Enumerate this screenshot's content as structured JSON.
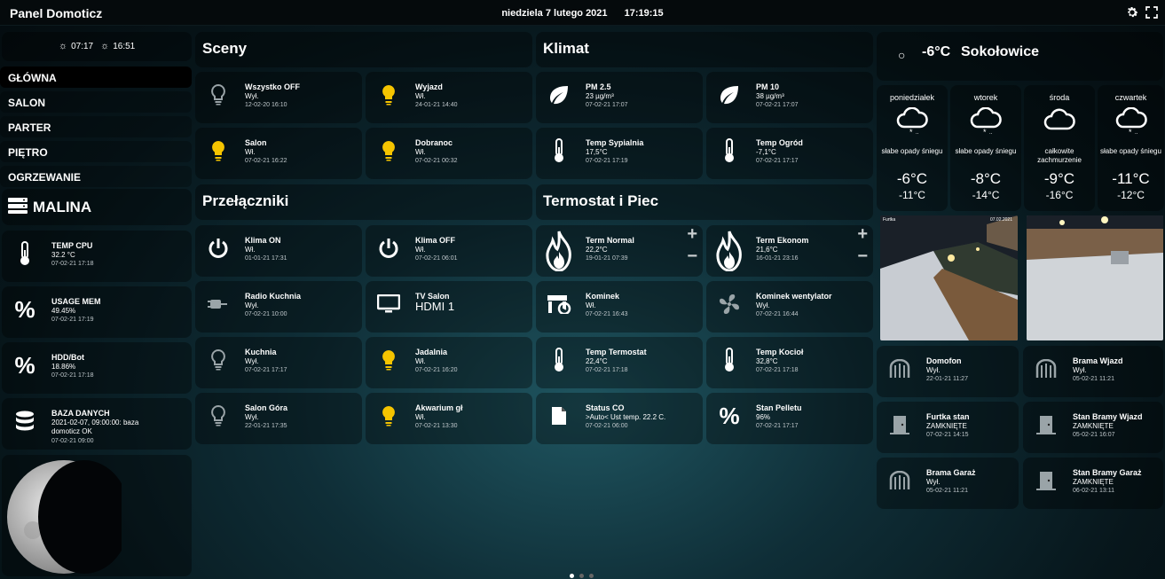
{
  "header": {
    "title": "Panel Domoticz",
    "date": "niedziela 7 lutego 2021",
    "time": "17:19:15"
  },
  "sun": {
    "sunrise": "07:17",
    "sunset": "16:51"
  },
  "nav": [
    {
      "label": "GŁÓWNA"
    },
    {
      "label": "SALON"
    },
    {
      "label": "PARTER"
    },
    {
      "label": "PIĘTRO"
    },
    {
      "label": "OGRZEWANIE"
    }
  ],
  "malina": {
    "title": "MALINA"
  },
  "system": [
    {
      "name": "TEMP CPU",
      "value": "32.2 °C",
      "time": "07-02-21 17:18"
    },
    {
      "name": "USAGE MEM",
      "value": "49.45%",
      "time": "07-02-21 17:19"
    },
    {
      "name": "HDD/Bot",
      "value": "18.86%",
      "time": "07-02-21 17:18"
    },
    {
      "name": "BAZA DANYCH",
      "value": "2021-02-07, 09:00:00: baza domoticz OK",
      "time": "07-02-21 09:00"
    }
  ],
  "sections": {
    "sceny": "Sceny",
    "klimat": "Klimat",
    "przelaczniki": "Przełączniki",
    "termostat": "Termostat i Piec"
  },
  "sceny": [
    {
      "name": "Wszystko OFF",
      "value": "Wył.",
      "time": "12-02-20 16:10",
      "icon": "bulb-off-icon"
    },
    {
      "name": "Wyjazd",
      "value": "Wł.",
      "time": "24-01-21 14:40",
      "icon": "bulb-on-icon"
    },
    {
      "name": "Salon",
      "value": "Wł.",
      "time": "07-02-21 16:22",
      "icon": "bulb-on-icon"
    },
    {
      "name": "Dobranoc",
      "value": "Wł.",
      "time": "07-02-21 00:32",
      "icon": "bulb-on-icon"
    }
  ],
  "klimat": [
    {
      "name": "PM 2.5",
      "value": "23 µg/m³",
      "time": "07-02-21 17:07",
      "icon": "leaf-icon"
    },
    {
      "name": "PM 10",
      "value": "38 µg/m³",
      "time": "07-02-21 17:07",
      "icon": "leaf-icon"
    },
    {
      "name": "Temp Sypialnia",
      "value": "17,5°C",
      "time": "07-02-21 17:19",
      "icon": "thermometer-icon"
    },
    {
      "name": "Temp Ogród",
      "value": "-7,1°C",
      "time": "07-02-21 17:17",
      "icon": "thermometer-icon"
    }
  ],
  "przelaczniki": [
    {
      "name": "Klima ON",
      "value": "Wł.",
      "time": "01-01-21 17:31",
      "icon": "power-icon"
    },
    {
      "name": "Klima OFF",
      "value": "Wł.",
      "time": "07-02-21 06:01",
      "icon": "power-icon"
    },
    {
      "name": "Radio Kuchnia",
      "value": "Wył.",
      "time": "07-02-21 10:00",
      "icon": "plug-icon"
    },
    {
      "name": "TV Salon",
      "value": "HDMI 1",
      "time": "",
      "icon": "monitor-icon"
    },
    {
      "name": "Kuchnia",
      "value": "Wył.",
      "time": "07-02-21 17:17",
      "icon": "bulb-off-icon"
    },
    {
      "name": "Jadalnia",
      "value": "Wł.",
      "time": "07-02-21 16:20",
      "icon": "bulb-on-icon"
    },
    {
      "name": "Salon Góra",
      "value": "Wył.",
      "time": "22-01-21 17:35",
      "icon": "bulb-off-icon"
    },
    {
      "name": "Akwarium gł",
      "value": "Wł.",
      "time": "07-02-21 13:30",
      "icon": "bulb-on-icon"
    }
  ],
  "termostat": [
    {
      "name": "Term Normal",
      "value": "22,2°C",
      "time": "19-01-21 07:39",
      "icon": "flame-icon"
    },
    {
      "name": "Term Ekonom",
      "value": "21,6°C",
      "time": "16-01-21 23:16",
      "icon": "flame-icon"
    },
    {
      "name": "Kominek",
      "value": "Wł.",
      "time": "07-02-21 16:43",
      "icon": "fireplace-icon"
    },
    {
      "name": "Kominek wentylator",
      "value": "Wył.",
      "time": "07-02-21 16:44",
      "icon": "fan-icon"
    },
    {
      "name": "Temp Termostat",
      "value": "22,4°C",
      "time": "07-02-21 17:18",
      "icon": "thermometer-icon"
    },
    {
      "name": "Temp Kocioł",
      "value": "32,8°C",
      "time": "07-02-21 17:18",
      "icon": "thermometer-icon"
    },
    {
      "name": "Status CO",
      "value": ">Auto< Ust temp. 22.2 C.",
      "time": "07-02-21 06:00",
      "icon": "document-icon"
    },
    {
      "name": "Stan Pelletu",
      "value": "96%",
      "time": "07-02-21 17:17",
      "icon": "percent-icon"
    }
  ],
  "weather": {
    "current_temp": "-6°C",
    "location": "Sokołowice",
    "days": [
      {
        "day": "poniedziałek",
        "desc": "słabe opady śniegu",
        "hi": "-6°C",
        "lo": "-11°C",
        "icon": "snow-cloud-icon"
      },
      {
        "day": "wtorek",
        "desc": "słabe opady śniegu",
        "hi": "-8°C",
        "lo": "-14°C",
        "icon": "snow-cloud-icon"
      },
      {
        "day": "środa",
        "desc": "całkowite zachmurzenie",
        "hi": "-9°C",
        "lo": "-16°C",
        "icon": "cloud-icon"
      },
      {
        "day": "czwartek",
        "desc": "słabe opady śniegu",
        "hi": "-11°C",
        "lo": "-12°C",
        "icon": "snow-cloud-icon"
      }
    ]
  },
  "cameras": [
    {
      "label": "Furtka",
      "stamp": "07.02.2021"
    },
    {
      "label": "",
      "stamp": ""
    }
  ],
  "gates": [
    {
      "name": "Domofon",
      "value": "Wył.",
      "time": "22-01-21 11:27",
      "icon": "gate-icon"
    },
    {
      "name": "Brama Wjazd",
      "value": "Wył.",
      "time": "05-02-21 11:21",
      "icon": "gate-icon"
    },
    {
      "name": "Furtka stan",
      "value": "ZAMKNIĘTE",
      "time": "07-02-21 14:15",
      "icon": "door-icon"
    },
    {
      "name": "Stan Bramy Wjazd",
      "value": "ZAMKNIĘTE",
      "time": "05-02-21 16:07",
      "icon": "door-icon"
    },
    {
      "name": "Brama Garaż",
      "value": "Wył.",
      "time": "05-02-21 11:21",
      "icon": "gate-icon"
    },
    {
      "name": "Stan Bramy Garaż",
      "value": "ZAMKNIĘTE",
      "time": "06-02-21 13:11",
      "icon": "door-icon"
    }
  ],
  "pagination": {
    "pages": 3,
    "active": 1
  },
  "colors": {
    "accent_bulb": "#f5c400",
    "icon_gray": "#9aa4a8",
    "tile_bg": "#000000"
  }
}
